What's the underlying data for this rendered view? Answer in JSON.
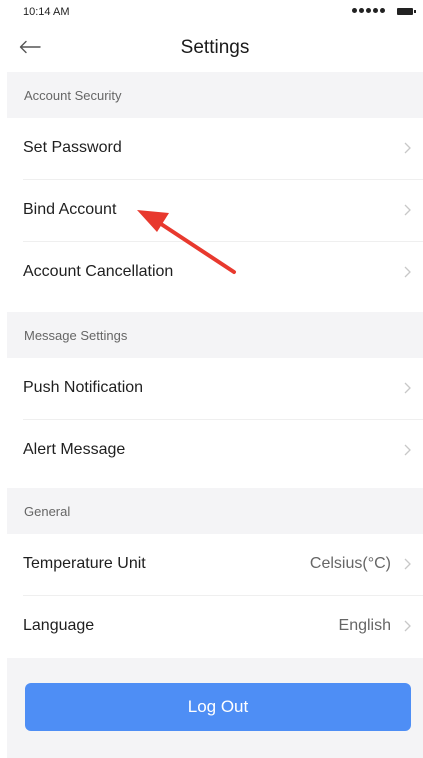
{
  "status_bar": {
    "time": "10:14 AM"
  },
  "header": {
    "title": "Settings"
  },
  "sections": {
    "account_security": {
      "title": "Account Security",
      "items": [
        {
          "label": "Set Password"
        },
        {
          "label": "Bind Account"
        },
        {
          "label": "Account Cancellation"
        }
      ]
    },
    "message_settings": {
      "title": "Message Settings",
      "items": [
        {
          "label": "Push Notification"
        },
        {
          "label": "Alert Message"
        }
      ]
    },
    "general": {
      "title": "General",
      "items": [
        {
          "label": "Temperature Unit",
          "value": "Celsius(°C)"
        },
        {
          "label": "Language",
          "value": "English"
        }
      ]
    }
  },
  "logout": {
    "label": "Log  Out"
  },
  "colors": {
    "accent": "#4e8ef5",
    "section_bg": "#f4f4f6",
    "annotation_arrow": "#e8392e"
  },
  "icons": [
    "back-arrow-icon",
    "chevron-right-icon",
    "signal-dots-icon",
    "battery-icon",
    "annotation-arrow"
  ]
}
